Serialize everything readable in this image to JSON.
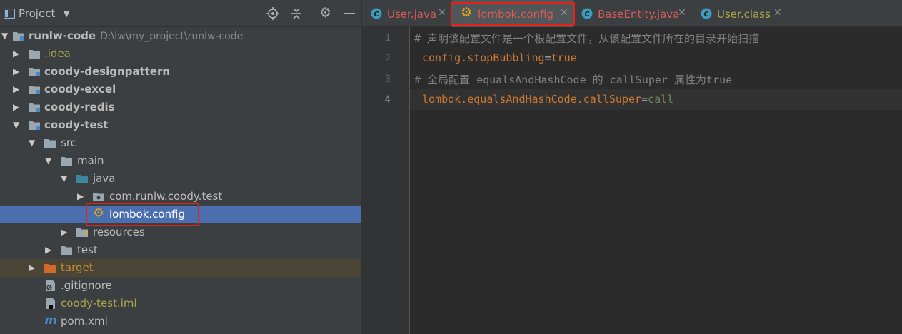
{
  "project_panel": {
    "title": "Project",
    "tree": [
      {
        "label": "runlw-code",
        "path": "D:\\lw\\my_project\\runlw-code"
      },
      {
        "label": ".idea"
      },
      {
        "label": "coody-designpattern"
      },
      {
        "label": "coody-excel"
      },
      {
        "label": "coody-redis"
      },
      {
        "label": "coody-test"
      },
      {
        "label": "src"
      },
      {
        "label": "main"
      },
      {
        "label": "java"
      },
      {
        "label": "com.runlw.coody.test"
      },
      {
        "label": "lombok.config"
      },
      {
        "label": "resources"
      },
      {
        "label": "test"
      },
      {
        "label": "target"
      },
      {
        "label": ".gitignore"
      },
      {
        "label": "coody-test.iml"
      },
      {
        "label": "pom.xml"
      }
    ]
  },
  "tabs": [
    {
      "label": "User.java",
      "icon": "java-class-icon"
    },
    {
      "label": "lombok.config",
      "icon": "config-gear-icon"
    },
    {
      "label": "BaseEntity.java",
      "icon": "java-class-icon"
    },
    {
      "label": "User.class",
      "icon": "java-class-icon"
    }
  ],
  "editor": {
    "line_numbers": [
      "1",
      "2",
      "3",
      "4"
    ],
    "lines": [
      {
        "comment": "# 声明该配置文件是一个根配置文件，从该配置文件所在的目录开始扫描"
      },
      {
        "key": "config.stopBubbling",
        "eq": "=",
        "value": "true"
      },
      {
        "comment": "# 全局配置 equalsAndHashCode 的 callSuper 属性为true"
      },
      {
        "key": "lombok.equalsAndHashCode.callSuper",
        "eq": "=",
        "value": "call"
      }
    ]
  },
  "colors": {
    "selection": "#4b6eaf",
    "highlight_box": "#e0241b",
    "java_class_icon": "#3b9dbd",
    "config_icon": "#e8a317"
  }
}
